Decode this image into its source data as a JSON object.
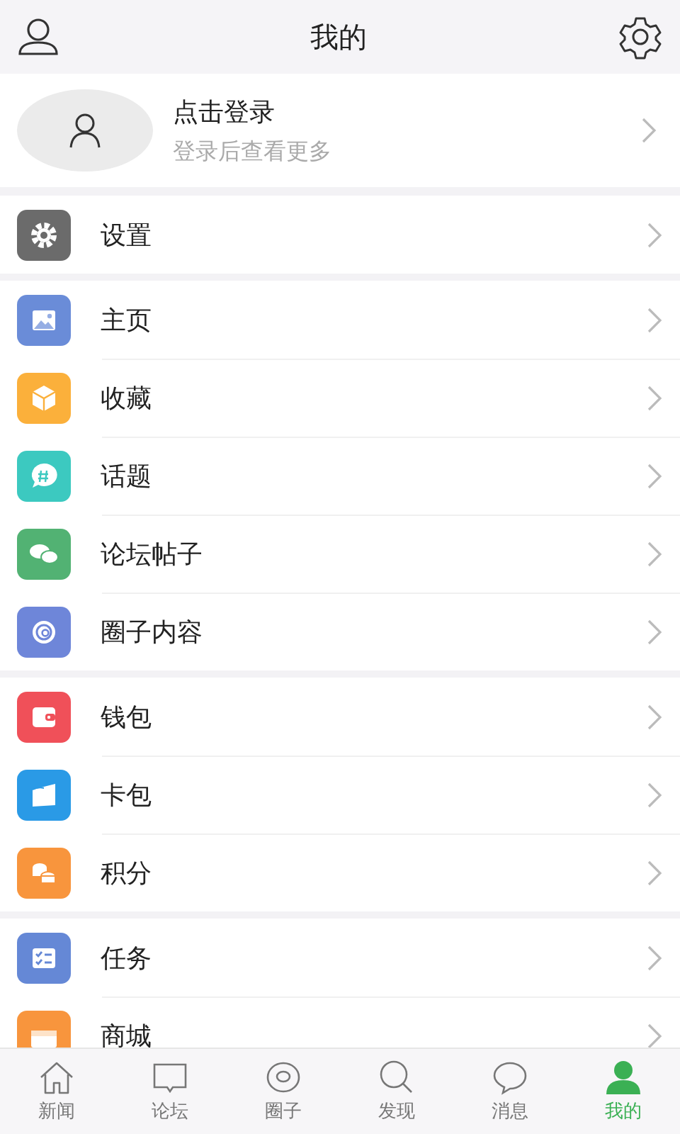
{
  "header": {
    "title": "我的"
  },
  "profile": {
    "name": "点击登录",
    "hint": "登录后查看更多"
  },
  "groups": [
    {
      "items": [
        {
          "label": "设置",
          "color": "#6b6b6b"
        }
      ]
    },
    {
      "items": [
        {
          "label": "主页",
          "color": "#6a8cd8"
        },
        {
          "label": "收藏",
          "color": "#fbb03b"
        },
        {
          "label": "话题",
          "color": "#3cc9c0"
        },
        {
          "label": "论坛帖子",
          "color": "#52b273"
        },
        {
          "label": "圈子内容",
          "color": "#6e86d9"
        }
      ]
    },
    {
      "items": [
        {
          "label": "钱包",
          "color": "#f05059"
        },
        {
          "label": "卡包",
          "color": "#2a9ae6"
        },
        {
          "label": "积分",
          "color": "#f8953d"
        }
      ]
    },
    {
      "items": [
        {
          "label": "任务",
          "color": "#6588d6"
        },
        {
          "label": "商城",
          "color": "#f8953d"
        }
      ]
    }
  ],
  "tabs": [
    {
      "label": "新闻",
      "selected": false
    },
    {
      "label": "论坛",
      "selected": false
    },
    {
      "label": "圈子",
      "selected": false
    },
    {
      "label": "发现",
      "selected": false
    },
    {
      "label": "消息",
      "selected": false
    },
    {
      "label": "我的",
      "selected": true
    }
  ]
}
